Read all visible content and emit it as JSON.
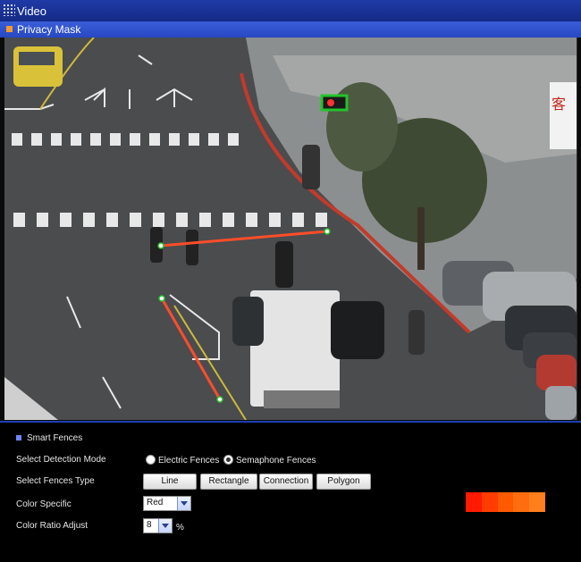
{
  "window": {
    "title": "Video"
  },
  "section": {
    "title": "Privacy Mask"
  },
  "video": {
    "sign_text": "客"
  },
  "smart_fences": {
    "title": "Smart Fences",
    "detection_mode": {
      "label": "Select Detection Mode",
      "options": [
        "Electric Fences",
        "Semaphone Fences"
      ],
      "selected": "Semaphone Fences"
    },
    "fences_type": {
      "label": "Select Fences Type",
      "buttons": [
        "Line",
        "Rectangle",
        "Connection",
        "Polygon"
      ]
    },
    "color_specific": {
      "label": "Color Specific",
      "value": "Red"
    },
    "color_ratio": {
      "label": "Color Ratio Adjust",
      "value": "8",
      "unit": "%"
    },
    "color_swatches": [
      "#ff1a00",
      "#ff3d00",
      "#ff5a00",
      "#ff6d10",
      "#ff7f1c"
    ]
  },
  "fence_color": "#ff4d2a",
  "marker_color": "#22c42a"
}
